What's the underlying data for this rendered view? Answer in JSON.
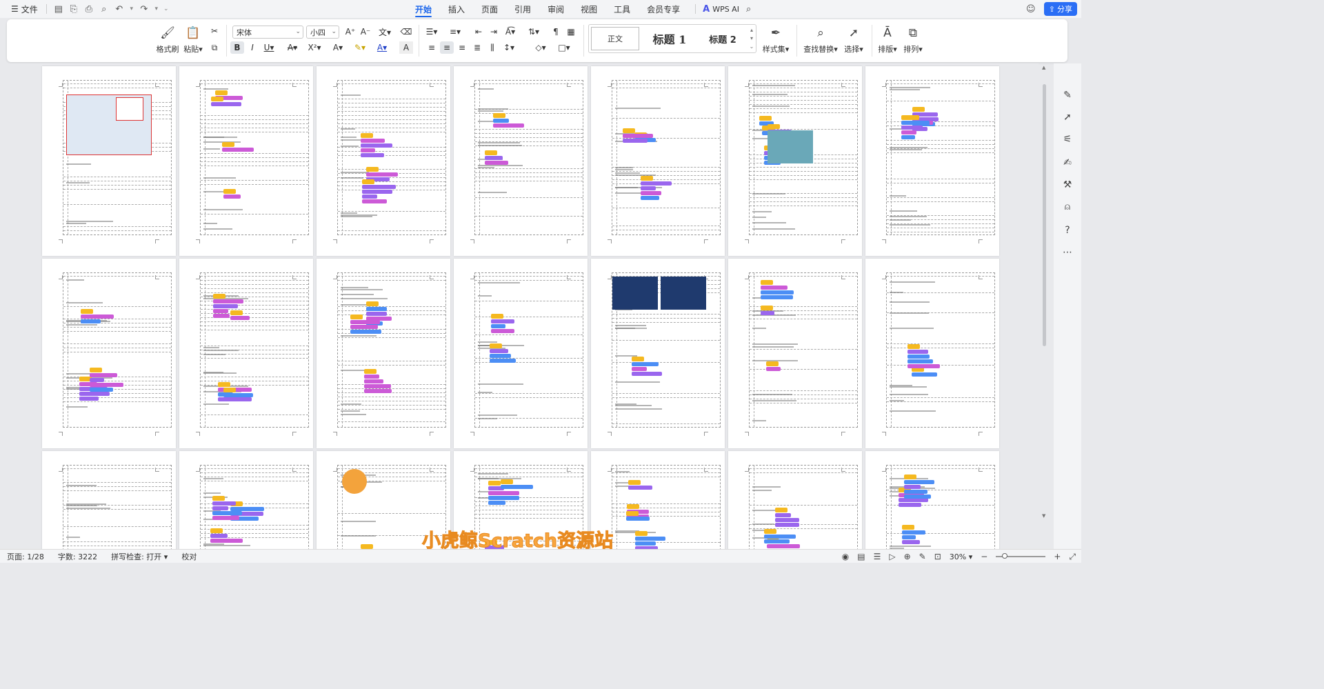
{
  "menubar": {
    "file_label": "文件",
    "tabs": [
      "开始",
      "插入",
      "页面",
      "引用",
      "审阅",
      "视图",
      "工具",
      "会员专享"
    ],
    "ai_label": "WPS AI",
    "share_label": "分享"
  },
  "ribbon": {
    "format_painter": "格式刷",
    "paste": "粘贴",
    "font_name": "宋体",
    "font_size": "小四",
    "style_normal": "正文",
    "style_h1": "标题 1",
    "style_h2": "标题 2",
    "style_set": "样式集",
    "find_replace": "查找替换",
    "select": "选择",
    "layout": "排版",
    "arrange": "排列"
  },
  "document": {
    "watermark": "小虎鲸Scratch资源站",
    "rows": 3,
    "columns": 7,
    "block_colors": {
      "event": "#f5b920",
      "motion": "#4c8ef5",
      "looks": "#9a66ee",
      "sound": "#cc5ad7"
    }
  },
  "statusbar": {
    "page": "页面: 1/28",
    "words": "字数: 3222",
    "spell": "拼写检查: 打开",
    "proof": "校对",
    "zoom": "30%"
  },
  "colors": {
    "accent": "#1a65eb",
    "share": "#2a6ef5",
    "watermark": "#f7a53e"
  }
}
